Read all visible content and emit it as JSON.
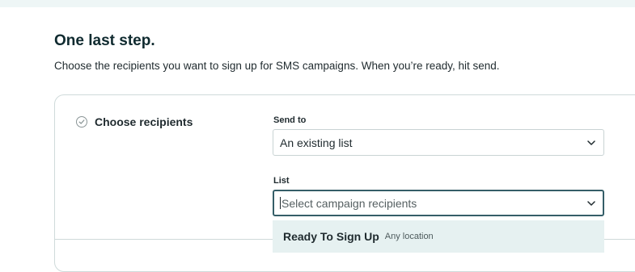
{
  "page": {
    "title": "One last step.",
    "description": "Choose the recipients you want to sign up for SMS campaigns. When you’re ready, hit send."
  },
  "step": {
    "label": "Choose recipients",
    "icon": "check-circle-icon"
  },
  "send_to": {
    "label": "Send to",
    "value": "An existing list",
    "icon": "chevron-down-icon"
  },
  "list": {
    "label": "List",
    "placeholder": "Select campaign recipients",
    "icon": "chevron-down-icon"
  },
  "dropdown": {
    "options": [
      {
        "name": "Ready To Sign Up",
        "meta": "Any location"
      }
    ]
  },
  "colors": {
    "accent": "#355e68",
    "highlight": "#e6f1f1",
    "border": "#cfdada"
  }
}
